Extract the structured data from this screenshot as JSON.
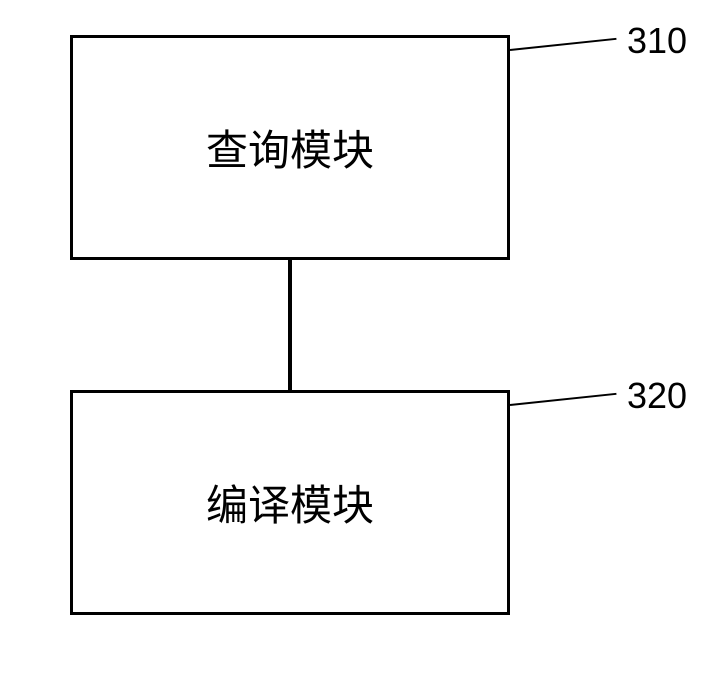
{
  "modules": {
    "top": {
      "label": "查询模块",
      "ref": "310"
    },
    "bottom": {
      "label": "编译模块",
      "ref": "320"
    }
  }
}
